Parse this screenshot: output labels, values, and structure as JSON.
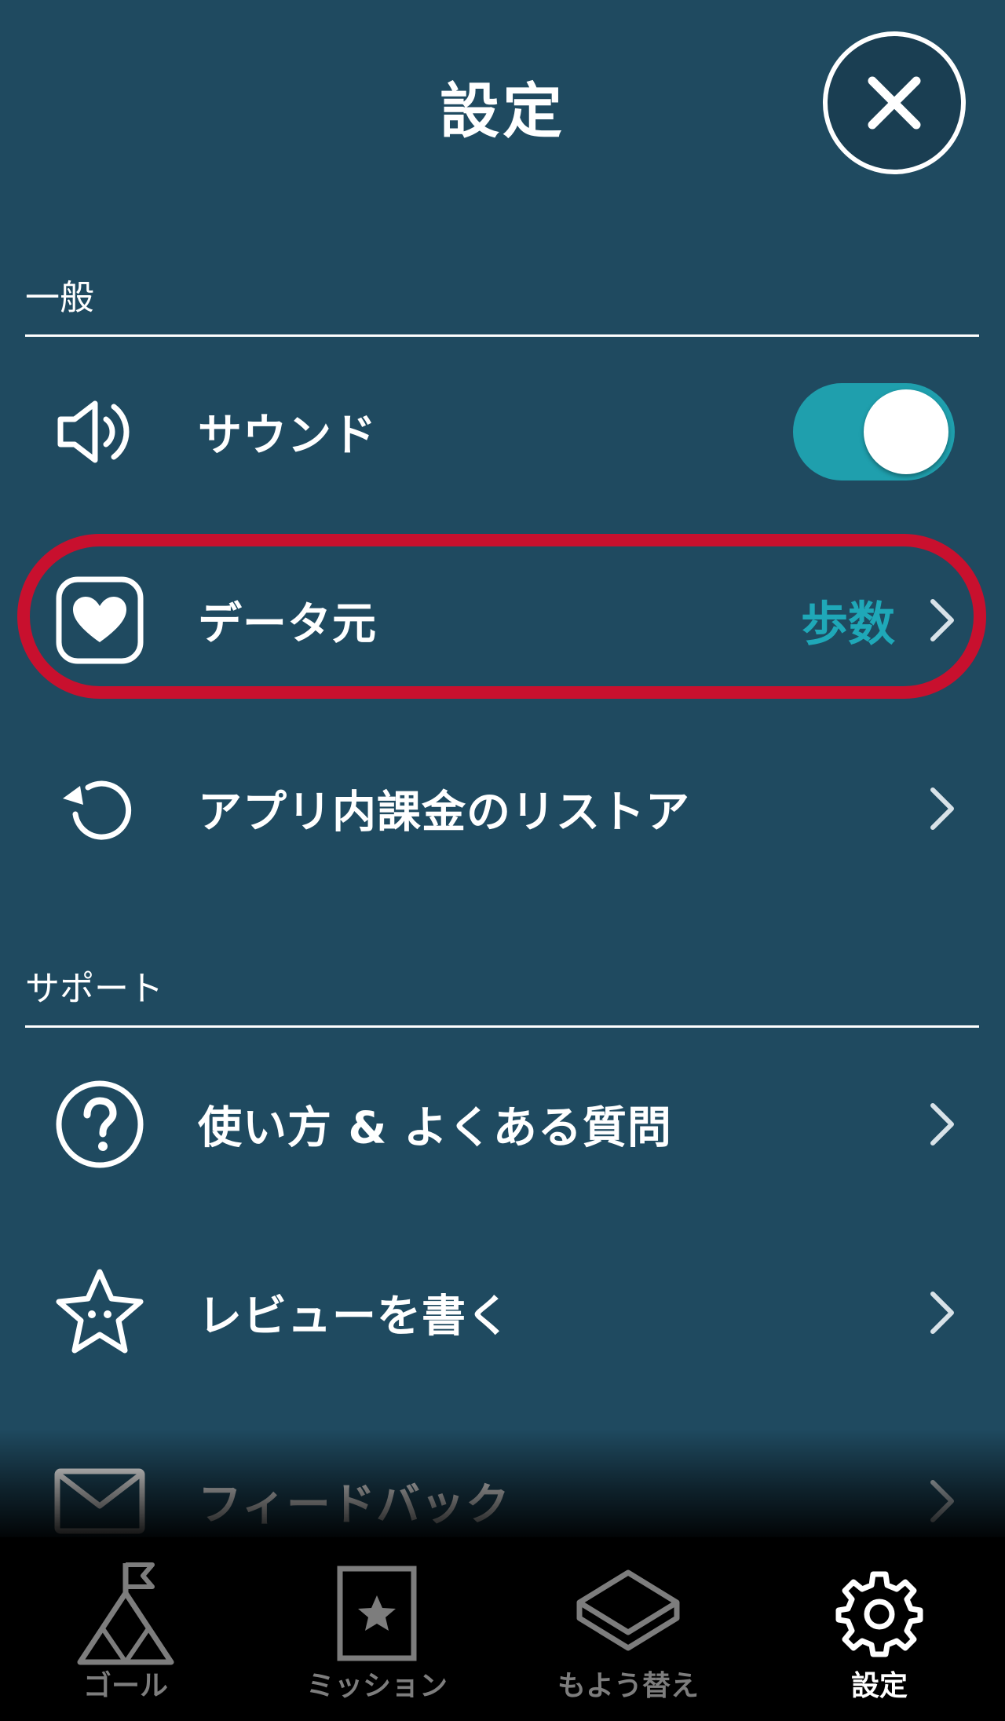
{
  "header": {
    "title": "設定",
    "close_icon": "close-icon"
  },
  "sections": {
    "general": {
      "label": "一般",
      "sound": {
        "label": "サウンド",
        "icon": "speaker-icon",
        "toggle_on": true
      },
      "data_source": {
        "label": "データ元",
        "icon": "heart-icon",
        "value": "歩数"
      },
      "restore": {
        "label": "アプリ内課金のリストア",
        "icon": "restore-icon"
      }
    },
    "support": {
      "label": "サポート",
      "faq": {
        "label": "使い方 & よくある質問",
        "icon": "question-icon"
      },
      "review": {
        "label": "レビューを書く",
        "icon": "star-icon"
      },
      "feedback": {
        "label": "フィードバック",
        "icon": "mail-icon"
      }
    }
  },
  "tabbar": {
    "tabs": [
      {
        "label": "ゴール",
        "icon": "mountain-flag-icon",
        "active": false
      },
      {
        "label": "ミッション",
        "icon": "star-card-icon",
        "active": false
      },
      {
        "label": "もよう替え",
        "icon": "layers-icon",
        "active": false
      },
      {
        "label": "設定",
        "icon": "gear-icon",
        "active": true
      }
    ]
  },
  "colors": {
    "background": "#1f4a60",
    "accent": "#1fa8b8",
    "highlight": "#c8102e",
    "tabbar": "#000000",
    "tab_inactive": "#7d7d7d"
  }
}
